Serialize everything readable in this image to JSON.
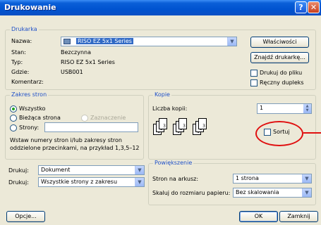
{
  "window": {
    "title": "Drukowanie",
    "help": "?",
    "close": "✕"
  },
  "printer": {
    "group_label": "Drukarka",
    "name_label": "Nazwa:",
    "name_value": "RISO EZ 5x1 Series",
    "status_label": "Stan:",
    "status_value": "Bezczynna",
    "type_label": "Typ:",
    "type_value": "RISO EZ 5x1 Series",
    "where_label": "Gdzie:",
    "where_value": "USB001",
    "comment_label": "Komentarz:",
    "properties_button": "Właściwości",
    "find_button": "Znajdź drukarkę...",
    "print_to_file": "Drukuj do pliku",
    "manual_duplex": "Ręczny dupleks"
  },
  "page_range": {
    "group_label": "Zakres stron",
    "all": "Wszystko",
    "current": "Bieżąca strona",
    "selection": "Zaznaczenie",
    "pages": "Strony:",
    "pages_value": "",
    "hint_line1": "Wstaw numery stron i/lub zakresy stron",
    "hint_line2": "oddzielone przecinkami, na przykład 1,3,5–12"
  },
  "copies": {
    "group_label": "Kopie",
    "count_label": "Liczba kopii:",
    "count_value": "1",
    "collate": "Sortuj",
    "pages": [
      "1",
      "2",
      "3"
    ]
  },
  "print_what": {
    "label": "Drukuj:",
    "value": "Dokument",
    "label2": "Drukuj:",
    "value2": "Wszystkie strony z zakresu"
  },
  "zoom": {
    "group_label": "Powiększenie",
    "pages_per_sheet_label": "Stron na arkusz:",
    "pages_per_sheet_value": "1 strona",
    "scale_label": "Skaluj do rozmiaru papieru:",
    "scale_value": "Bez skalowania"
  },
  "footer": {
    "options": "Opcje...",
    "ok": "OK",
    "close": "Zamknij"
  },
  "colors": {
    "title_bar": "#0053d0",
    "group_label": "#1f50c8",
    "highlight": "#316ac5",
    "annotation": "#e01010"
  }
}
